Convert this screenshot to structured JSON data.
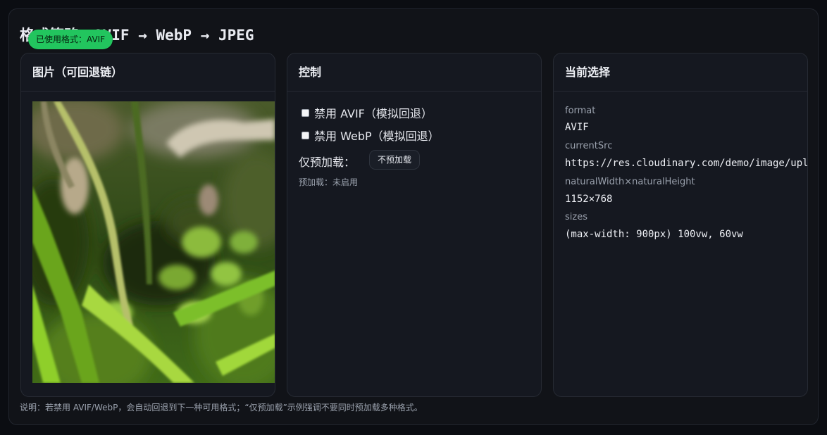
{
  "page": {
    "title": "格式策略：AVIF → WebP → JPEG",
    "badge": "已使用格式：AVIF",
    "footer": "说明：若禁用 AVIF/WebP，会自动回退到下一种可用格式；“仅预加载”示例强调不要同时预加载多种格式。"
  },
  "image_card": {
    "title": "图片（可回退链）"
  },
  "controls_card": {
    "title": "控制",
    "disable_avif": {
      "label": "禁用 AVIF（模拟回退）",
      "checked": false
    },
    "disable_webp": {
      "label": "禁用 WebP（模拟回退）",
      "checked": false
    },
    "preload_label": "仅预加载：",
    "preload_button": "不预加载",
    "preload_status": "预加载：未启用"
  },
  "current_card": {
    "title": "当前选择",
    "fields": [
      {
        "label": "format",
        "value": "AVIF"
      },
      {
        "label": "currentSrc",
        "value": "https://res.cloudinary.com/demo/image/upload/f_avif/sample.jpg"
      },
      {
        "label": "naturalWidth×naturalHeight",
        "value": "1152×768"
      },
      {
        "label": "sizes",
        "value": "(max-width: 900px) 100vw, 60vw"
      }
    ]
  },
  "colors": {
    "background": "#0b0d12",
    "card": "#151820",
    "accent": "#22c55e"
  }
}
